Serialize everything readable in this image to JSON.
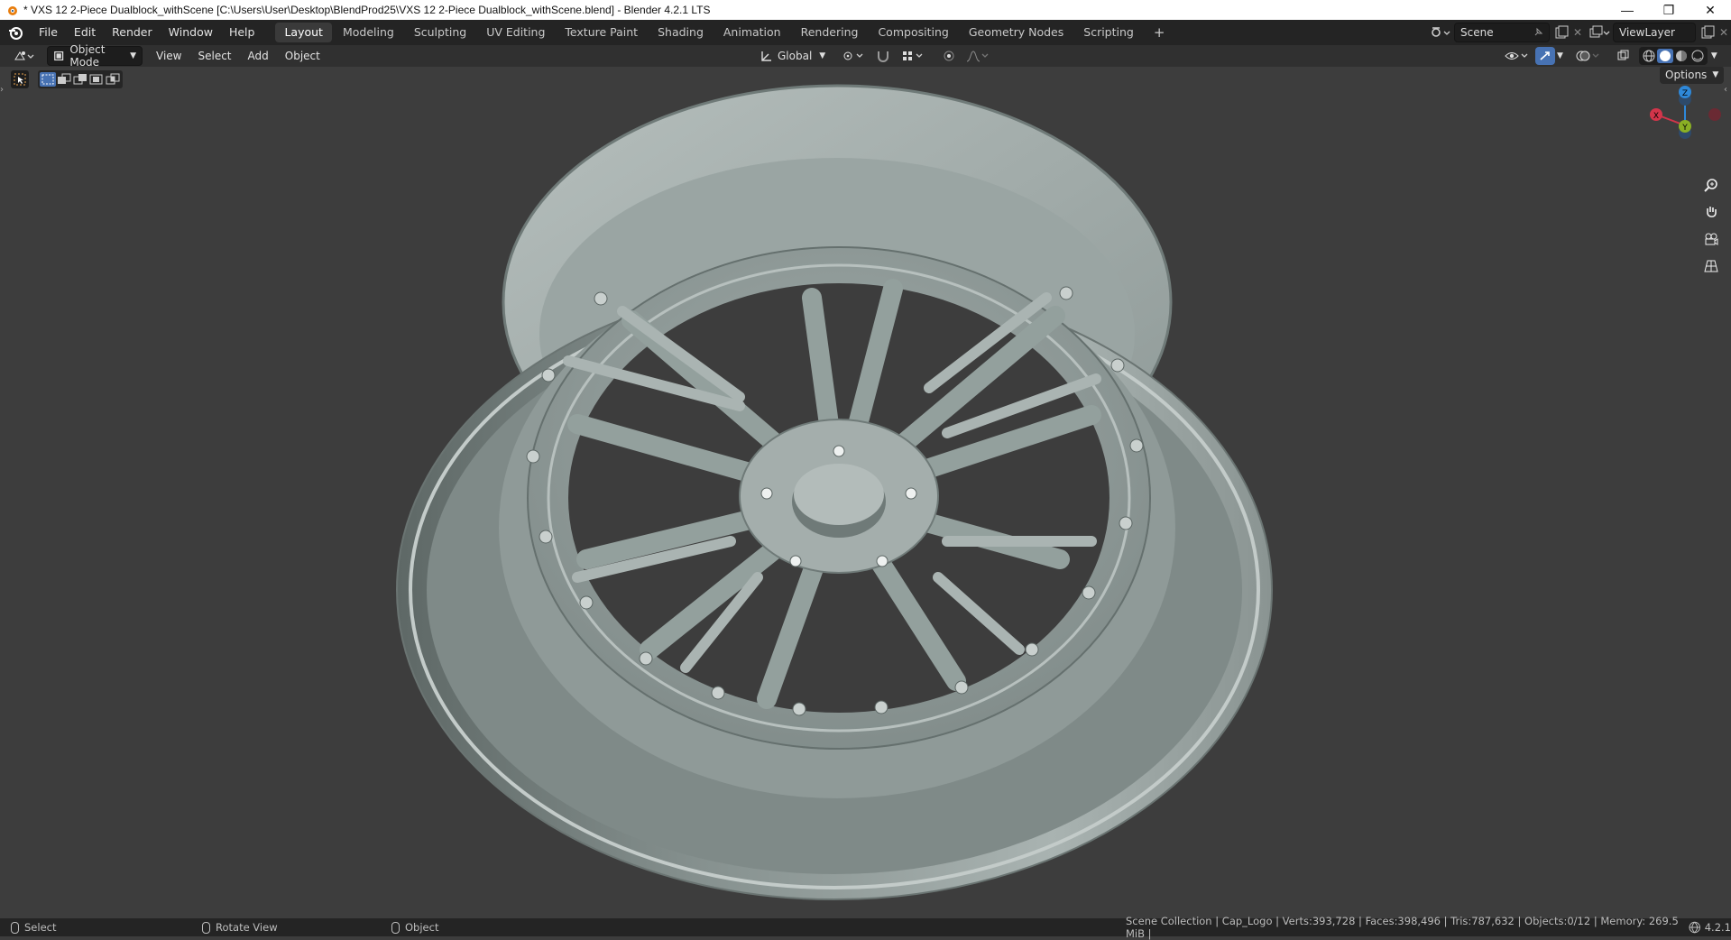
{
  "window": {
    "title": "* VXS 12 2-Piece Dualblock_withScene [C:\\Users\\User\\Desktop\\BlendProd25\\VXS 12 2-Piece Dualblock_withScene.blend] - Blender 4.2.1 LTS",
    "minimize_glyph": "—",
    "restore_glyph": "❐",
    "close_glyph": "✕"
  },
  "menu": [
    "File",
    "Edit",
    "Render",
    "Window",
    "Help"
  ],
  "workspaces": [
    "Layout",
    "Modeling",
    "Sculpting",
    "UV Editing",
    "Texture Paint",
    "Shading",
    "Animation",
    "Rendering",
    "Compositing",
    "Geometry Nodes",
    "Scripting"
  ],
  "active_workspace": "Layout",
  "add_workspace_glyph": "+",
  "scene": {
    "name": "Scene"
  },
  "view_layer": {
    "name": "ViewLayer"
  },
  "header": {
    "mode": "Object Mode",
    "menus": [
      "View",
      "Select",
      "Add",
      "Object"
    ],
    "transform_orientation": "Global"
  },
  "viewport": {
    "options_label": "Options",
    "gizmo": {
      "z": "Z",
      "x": "X",
      "y": "Y"
    }
  },
  "status": {
    "select": "Select",
    "rotate": "Rotate View",
    "object": "Object",
    "stats": "Scene Collection | Cap_Logo | Verts:393,728 | Faces:398,496 | Tris:787,632 | Objects:0/12 | Memory: 269.5 MiB |",
    "version": "4.2.1"
  },
  "colors": {
    "accent_blue": "#4772b3",
    "axis_x": "#d2354a",
    "axis_y": "#8ab024",
    "axis_z": "#2e88d9",
    "wheel": "#8e9a97"
  }
}
